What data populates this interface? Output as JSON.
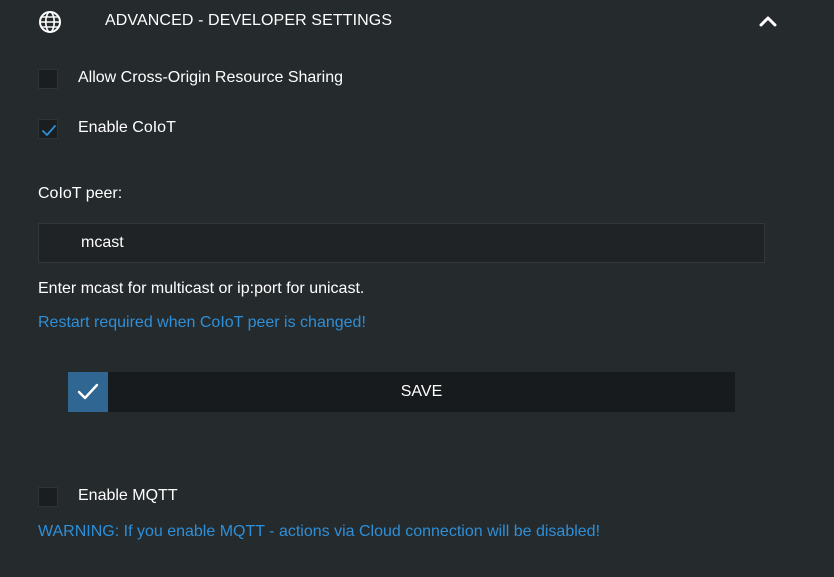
{
  "header": {
    "title": "ADVANCED - DEVELOPER SETTINGS",
    "icon": "globe-icon",
    "collapse_icon": "chevron-up-icon"
  },
  "settings": {
    "cors": {
      "label": "Allow Cross-Origin Resource Sharing",
      "checked": false
    },
    "coiot": {
      "label": "Enable CoIoT",
      "checked": true
    },
    "coiot_peer": {
      "label": "CoIoT peer:",
      "value": "mcast",
      "hint": "Enter mcast for multicast or ip:port for unicast.",
      "notice": "Restart required when CoIoT peer is changed!"
    },
    "save": {
      "label": "SAVE",
      "icon": "check-icon"
    },
    "mqtt": {
      "label": "Enable MQTT",
      "checked": false,
      "warning": "WARNING: If you enable MQTT - actions via Cloud connection will be disabled!"
    }
  },
  "colors": {
    "background": "#252a2d",
    "accent": "#2e8fd8",
    "save_icon_bg": "#2f6792"
  }
}
